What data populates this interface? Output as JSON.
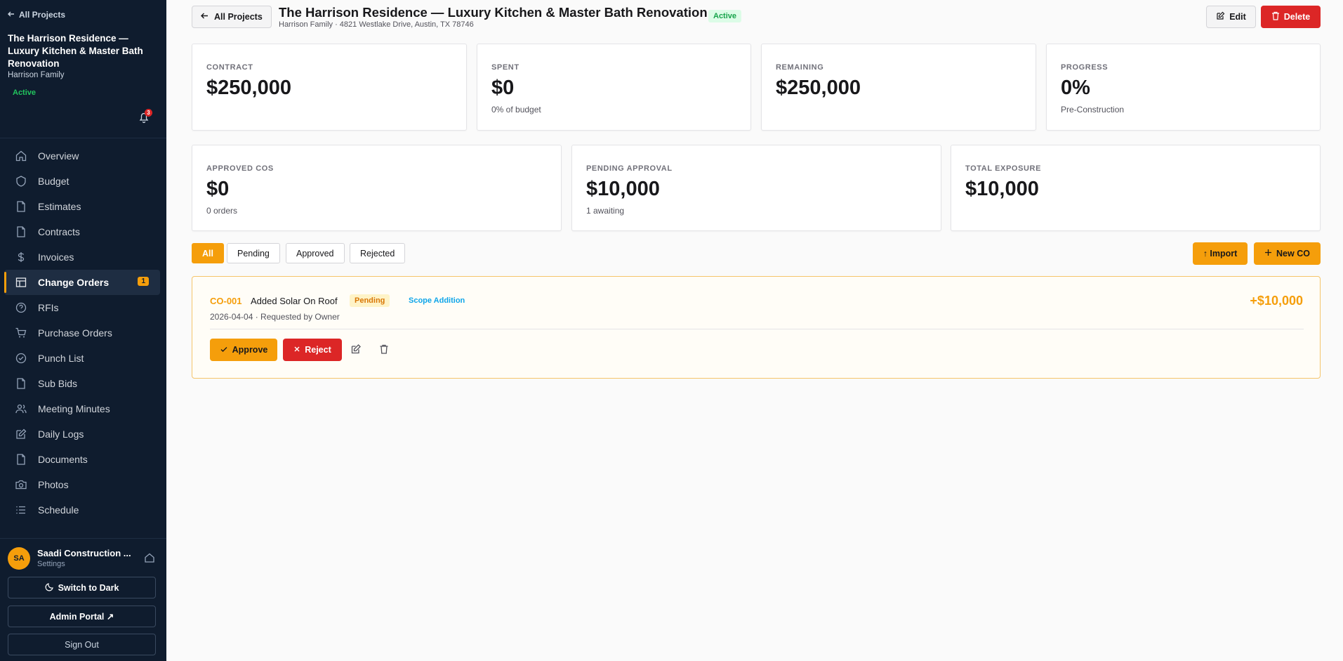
{
  "sidebar": {
    "back_label": "All Projects",
    "project_title": "The Harrison Residence — Luxury Kitchen & Master Bath Renovation",
    "client": "Harrison Family",
    "status": "Active",
    "notification_count": "3",
    "nav": [
      {
        "label": "Overview",
        "icon": "home-icon"
      },
      {
        "label": "Budget",
        "icon": "shield-icon"
      },
      {
        "label": "Estimates",
        "icon": "file-icon"
      },
      {
        "label": "Contracts",
        "icon": "file-icon"
      },
      {
        "label": "Invoices",
        "icon": "dollar-icon"
      },
      {
        "label": "Change Orders",
        "icon": "table-icon",
        "badge": "1",
        "active": true
      },
      {
        "label": "RFIs",
        "icon": "help-circle-icon"
      },
      {
        "label": "Purchase Orders",
        "icon": "cart-icon"
      },
      {
        "label": "Punch List",
        "icon": "check-circle-icon"
      },
      {
        "label": "Sub Bids",
        "icon": "file-icon"
      },
      {
        "label": "Meeting Minutes",
        "icon": "users-icon"
      },
      {
        "label": "Daily Logs",
        "icon": "edit-icon"
      },
      {
        "label": "Documents",
        "icon": "file-icon"
      },
      {
        "label": "Photos",
        "icon": "camera-icon"
      },
      {
        "label": "Schedule",
        "icon": "list-icon"
      }
    ],
    "footer": {
      "avatar_initials": "SA",
      "org_name": "Saadi Construction ...",
      "org_sub": "Settings",
      "theme_button": "Switch to Dark",
      "admin_button": "Admin Portal ↗",
      "signout_button": "Sign Out"
    }
  },
  "header": {
    "back_label": "All Projects",
    "title": "The Harrison Residence — Luxury Kitchen & Master Bath Renovation",
    "status": "Active",
    "subtitle": "Harrison Family · 4821 Westlake Drive, Austin, TX 78746",
    "edit_label": "Edit",
    "delete_label": "Delete"
  },
  "stats_top": [
    {
      "label": "CONTRACT",
      "value": "$250,000",
      "sub": ""
    },
    {
      "label": "SPENT",
      "value": "$0",
      "sub": "0% of budget"
    },
    {
      "label": "REMAINING",
      "value": "$250,000",
      "sub": ""
    },
    {
      "label": "PROGRESS",
      "value": "0%",
      "sub": "Pre-Construction"
    }
  ],
  "stats_bottom": [
    {
      "label": "APPROVED COS",
      "value": "$0",
      "sub": "0 orders"
    },
    {
      "label": "PENDING APPROVAL",
      "value": "$10,000",
      "sub": "1 awaiting"
    },
    {
      "label": "TOTAL EXPOSURE",
      "value": "$10,000",
      "sub": ""
    }
  ],
  "filters": [
    "All",
    "Pending",
    "Approved",
    "Rejected"
  ],
  "actions": {
    "import_label": "↑ Import",
    "new_label": "New CO"
  },
  "change_orders": [
    {
      "id": "CO-001",
      "title": "Added Solar On Roof",
      "status": "Pending",
      "type": "Scope Addition",
      "meta": "2026-04-04 · Requested by Owner",
      "amount": "+$10,000",
      "approve_label": "Approve",
      "reject_label": "Reject"
    }
  ],
  "colors": {
    "sidebar_bg": "#0f1c2e",
    "accent": "#f59e0b",
    "danger": "#dc2626",
    "success": "#16a34a"
  }
}
